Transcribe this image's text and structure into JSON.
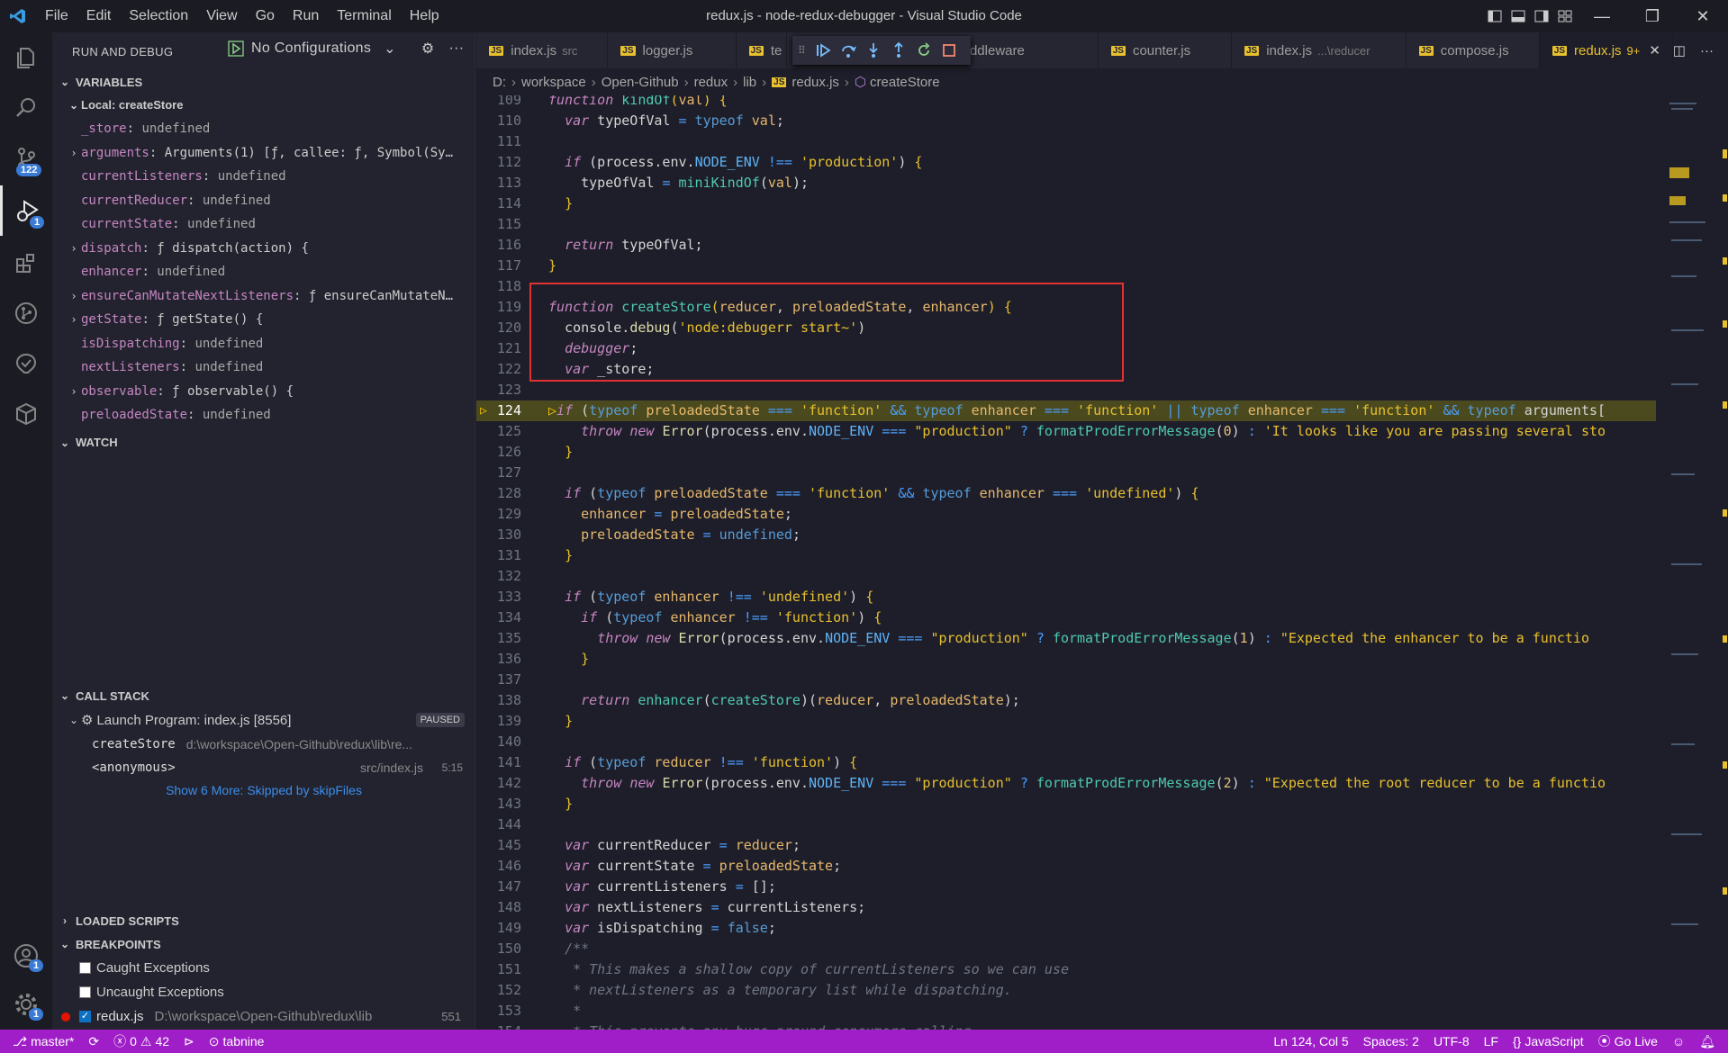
{
  "titlebar": {
    "menu": [
      "File",
      "Edit",
      "Selection",
      "View",
      "Go",
      "Run",
      "Terminal",
      "Help"
    ],
    "title": "redux.js - node-redux-debugger - Visual Studio Code"
  },
  "activity": {
    "scm_badge": "122",
    "debug_badge": "1",
    "accounts_badge": "1",
    "settings_badge": "1"
  },
  "sidebar": {
    "header": "RUN AND DEBUG",
    "config": "No Configurations",
    "variables": {
      "title": "VARIABLES",
      "scope": "Local: createStore",
      "rows": [
        {
          "name": "_store",
          "value": "undefined",
          "expandable": false
        },
        {
          "name": "arguments",
          "value": "Arguments(1) [ƒ, callee: ƒ, Symbol(Sy…",
          "expandable": true
        },
        {
          "name": "currentListeners",
          "value": "undefined",
          "expandable": false
        },
        {
          "name": "currentReducer",
          "value": "undefined",
          "expandable": false
        },
        {
          "name": "currentState",
          "value": "undefined",
          "expandable": false
        },
        {
          "name": "dispatch",
          "value": "ƒ dispatch(action) {",
          "expandable": true
        },
        {
          "name": "enhancer",
          "value": "undefined",
          "expandable": false
        },
        {
          "name": "ensureCanMutateNextListeners",
          "value": "ƒ ensureCanMutateN…",
          "expandable": true
        },
        {
          "name": "getState",
          "value": "ƒ getState() {",
          "expandable": true
        },
        {
          "name": "isDispatching",
          "value": "undefined",
          "expandable": false
        },
        {
          "name": "nextListeners",
          "value": "undefined",
          "expandable": false
        },
        {
          "name": "observable",
          "value": "ƒ observable() {",
          "expandable": true
        },
        {
          "name": "preloadedState",
          "value": "undefined",
          "expandable": false
        }
      ]
    },
    "watch": {
      "title": "WATCH"
    },
    "callstack": {
      "title": "CALL STACK",
      "program": "Launch Program: index.js [8556]",
      "status": "PAUSED",
      "frames": [
        {
          "name": "createStore",
          "path": "d:\\workspace\\Open-Github\\redux\\lib\\re...",
          "line": ""
        },
        {
          "name": "<anonymous>",
          "path": "src/index.js",
          "line": "5:15"
        }
      ],
      "more": "Show 6 More: Skipped by skipFiles"
    },
    "loaded_scripts": "LOADED SCRIPTS",
    "breakpoints": {
      "title": "BREAKPOINTS",
      "items": [
        {
          "label": "Caught Exceptions",
          "checked": false
        },
        {
          "label": "Uncaught Exceptions",
          "checked": false
        }
      ],
      "file": {
        "name": "redux.js",
        "path": "D:\\workspace\\Open-Github\\redux\\lib",
        "line": "551"
      }
    }
  },
  "tabs": [
    {
      "name": "index.js",
      "desc": "src"
    },
    {
      "name": "logger.js",
      "desc": ""
    },
    {
      "name": "te",
      "desc": ""
    },
    {
      "name": "iddleware",
      "desc": ""
    },
    {
      "name": "counter.js",
      "desc": ""
    },
    {
      "name": "index.js",
      "desc": "...\\reducer"
    },
    {
      "name": "compose.js",
      "desc": ""
    },
    {
      "name": "redux.js",
      "desc": "9+",
      "active": true
    }
  ],
  "breadcrumb": [
    "D:",
    "workspace",
    "Open-Github",
    "redux",
    "lib",
    "redux.js",
    "createStore"
  ],
  "statusbar": {
    "branch": "master*",
    "errors": "0",
    "warnings": "42",
    "tabnine": "tabnine",
    "position": "Ln 124, Col 5",
    "spaces": "Spaces: 2",
    "encoding": "UTF-8",
    "eol": "LF",
    "language": "JavaScript",
    "golive": "Go Live"
  }
}
